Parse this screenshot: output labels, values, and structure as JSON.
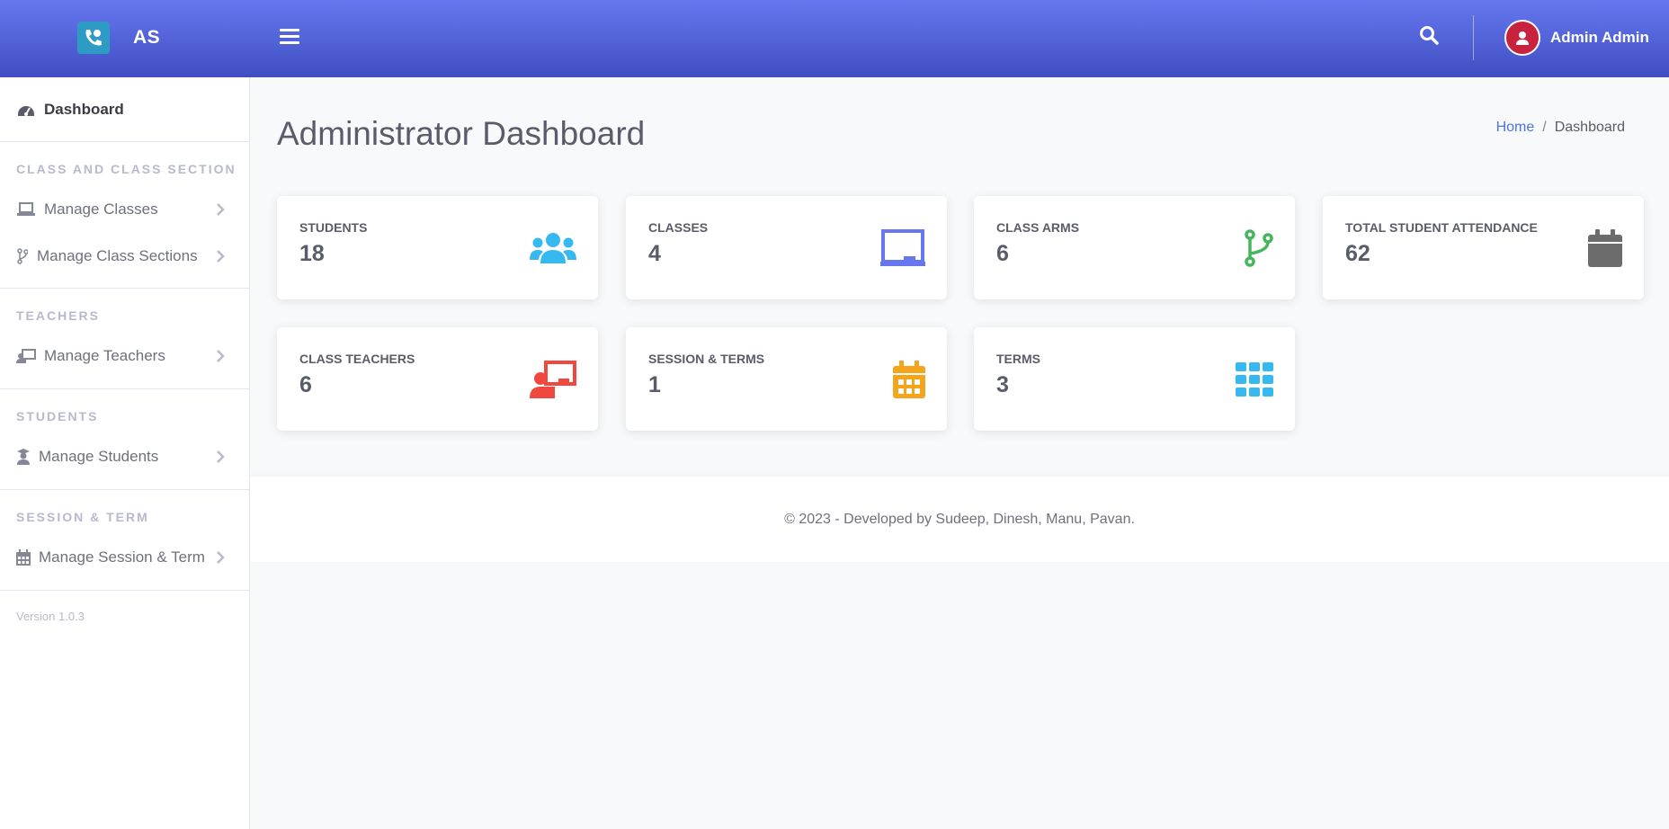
{
  "header": {
    "brand": "AS",
    "user_name": "Admin Admin",
    "colors": {
      "gradient_top": "#6777ef",
      "gradient_bottom": "#3f4fc2",
      "avatar": "#c8223f"
    }
  },
  "sidebar": {
    "dashboard_label": "Dashboard",
    "sections": [
      {
        "heading": "CLASS AND CLASS SECTION",
        "items": [
          {
            "label": "Manage Classes",
            "icon": "laptop-icon"
          },
          {
            "label": "Manage Class Sections",
            "icon": "code-branch-icon"
          }
        ]
      },
      {
        "heading": "TEACHERS",
        "items": [
          {
            "label": "Manage Teachers",
            "icon": "chalkboard-teacher-icon"
          }
        ]
      },
      {
        "heading": "STUDENTS",
        "items": [
          {
            "label": "Manage Students",
            "icon": "user-graduate-icon"
          }
        ]
      },
      {
        "heading": "SESSION & TERM",
        "items": [
          {
            "label": "Manage Session & Term",
            "icon": "calendar-icon"
          }
        ]
      }
    ],
    "version": "Version 1.0.3"
  },
  "main": {
    "title": "Administrator Dashboard",
    "breadcrumb": {
      "home": "Home",
      "sep": "/",
      "current": "Dashboard"
    },
    "cards": [
      {
        "label": "STUDENTS",
        "value": "18",
        "icon": "users-icon",
        "color": "#36b9f0"
      },
      {
        "label": "CLASSES",
        "value": "4",
        "icon": "chalkboard-icon",
        "color": "#6777ef"
      },
      {
        "label": "CLASS ARMS",
        "value": "6",
        "icon": "code-branch-icon",
        "color": "#47b55d"
      },
      {
        "label": "TOTAL STUDENT ATTENDANCE",
        "value": "62",
        "icon": "calendar-icon",
        "color": "#6c6c6c"
      },
      {
        "label": "CLASS TEACHERS",
        "value": "6",
        "icon": "chalkboard-teacher-icon",
        "color": "#f0483e"
      },
      {
        "label": "SESSION & TERMS",
        "value": "1",
        "icon": "calendar-alt-icon",
        "color": "#f4a51c"
      },
      {
        "label": "TERMS",
        "value": "3",
        "icon": "th-icon",
        "color": "#36b9f0"
      }
    ]
  },
  "footer": {
    "text": "© 2023 - Developed by Sudeep, Dinesh, Manu, Pavan."
  }
}
